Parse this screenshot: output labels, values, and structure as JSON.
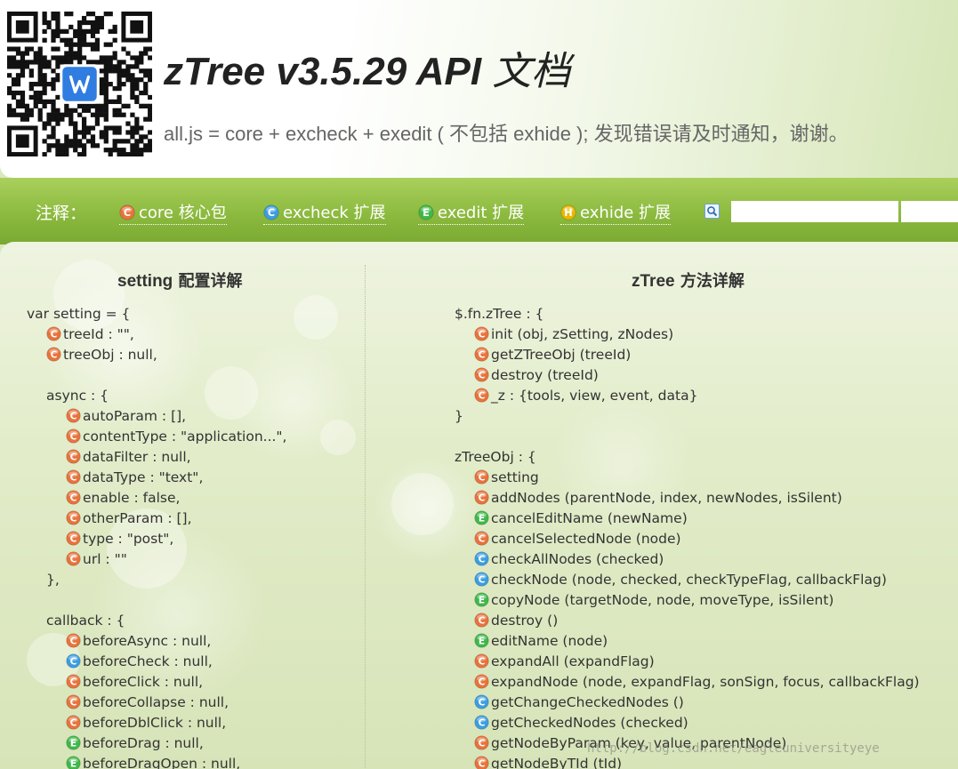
{
  "header": {
    "title_latin": "zTree v3.5.29 API ",
    "title_cn": "文档",
    "subtitle": "all.js = core + excheck + exedit ( 不包括 exhide ); 发现错误请及时通知，谢谢。"
  },
  "legend": {
    "label": "注释：",
    "items": [
      {
        "badge": "C",
        "text": "core 核心包",
        "color": "#e8733c"
      },
      {
        "badge": "C",
        "text": "excheck 扩展",
        "color": "#3b9ee0"
      },
      {
        "badge": "E",
        "text": "exedit 扩展",
        "color": "#3fb84a"
      },
      {
        "badge": "H",
        "text": "exhide 扩展",
        "color": "#e8b800"
      }
    ],
    "search_value": ""
  },
  "colors": {
    "core": "#e8733c",
    "excheck": "#3b9ee0",
    "exedit": "#3fb84a",
    "exhide": "#e8b800"
  },
  "left": {
    "heading_latin": "setting",
    "heading_cn": " 配置详解",
    "lines": [
      {
        "indent": 0,
        "text": "var setting = {"
      },
      {
        "indent": 1,
        "badge": "core",
        "text": "treeId : \"\","
      },
      {
        "indent": 1,
        "badge": "core",
        "text": "treeObj : null,"
      },
      {
        "indent": 0,
        "text": ""
      },
      {
        "indent": 1,
        "text": "async : {"
      },
      {
        "indent": 2,
        "badge": "core",
        "text": "autoParam : [],"
      },
      {
        "indent": 2,
        "badge": "core",
        "text": "contentType : \"application...\","
      },
      {
        "indent": 2,
        "badge": "core",
        "text": "dataFilter : null,"
      },
      {
        "indent": 2,
        "badge": "core",
        "text": "dataType : \"text\","
      },
      {
        "indent": 2,
        "badge": "core",
        "text": "enable : false,"
      },
      {
        "indent": 2,
        "badge": "core",
        "text": "otherParam : [],"
      },
      {
        "indent": 2,
        "badge": "core",
        "text": "type : \"post\","
      },
      {
        "indent": 2,
        "badge": "core",
        "text": "url : \"\""
      },
      {
        "indent": 1,
        "text": "},"
      },
      {
        "indent": 0,
        "text": ""
      },
      {
        "indent": 1,
        "text": "callback : {"
      },
      {
        "indent": 2,
        "badge": "core",
        "text": "beforeAsync : null,"
      },
      {
        "indent": 2,
        "badge": "excheck",
        "text": "beforeCheck : null,"
      },
      {
        "indent": 2,
        "badge": "core",
        "text": "beforeClick : null,"
      },
      {
        "indent": 2,
        "badge": "core",
        "text": "beforeCollapse : null,"
      },
      {
        "indent": 2,
        "badge": "core",
        "text": "beforeDblClick : null,"
      },
      {
        "indent": 2,
        "badge": "exedit",
        "text": "beforeDrag : null,"
      },
      {
        "indent": 2,
        "badge": "exedit",
        "text": "beforeDragOpen : null,"
      }
    ]
  },
  "right": {
    "heading_latin": "zTree",
    "heading_cn": " 方法详解",
    "lines": [
      {
        "indent": 0,
        "text": "$.fn.zTree : {"
      },
      {
        "indent": 1,
        "badge": "core",
        "text": "init (obj, zSetting, zNodes)"
      },
      {
        "indent": 1,
        "badge": "core",
        "text": "getZTreeObj (treeId)"
      },
      {
        "indent": 1,
        "badge": "core",
        "text": "destroy (treeId)"
      },
      {
        "indent": 1,
        "badge": "core",
        "text": "_z : {tools, view, event, data}"
      },
      {
        "indent": 0,
        "text": "}"
      },
      {
        "indent": 0,
        "text": ""
      },
      {
        "indent": 0,
        "text": "zTreeObj : {"
      },
      {
        "indent": 1,
        "badge": "core",
        "text": "setting"
      },
      {
        "indent": 1,
        "badge": "core",
        "text": "addNodes (parentNode, index, newNodes, isSilent)"
      },
      {
        "indent": 1,
        "badge": "exedit",
        "text": "cancelEditName (newName)"
      },
      {
        "indent": 1,
        "badge": "core",
        "text": "cancelSelectedNode (node)"
      },
      {
        "indent": 1,
        "badge": "excheck",
        "text": "checkAllNodes (checked)"
      },
      {
        "indent": 1,
        "badge": "excheck",
        "text": "checkNode (node, checked, checkTypeFlag, callbackFlag)"
      },
      {
        "indent": 1,
        "badge": "exedit",
        "text": "copyNode (targetNode, node, moveType, isSilent)"
      },
      {
        "indent": 1,
        "badge": "core",
        "text": "destroy ()"
      },
      {
        "indent": 1,
        "badge": "exedit",
        "text": "editName (node)"
      },
      {
        "indent": 1,
        "badge": "core",
        "text": "expandAll (expandFlag)"
      },
      {
        "indent": 1,
        "badge": "core",
        "text": "expandNode (node, expandFlag, sonSign, focus, callbackFlag)"
      },
      {
        "indent": 1,
        "badge": "excheck",
        "text": "getChangeCheckedNodes ()"
      },
      {
        "indent": 1,
        "badge": "excheck",
        "text": "getCheckedNodes (checked)"
      },
      {
        "indent": 1,
        "badge": "core",
        "text": "getNodeByParam (key, value, parentNode)"
      },
      {
        "indent": 1,
        "badge": "core",
        "text": "getNodeByTId (tId)"
      }
    ]
  },
  "watermark": "http://blog.csdn.net/eagleuniversityeye",
  "badge_letters": {
    "core": "C",
    "excheck": "C",
    "exedit": "E",
    "exhide": "H"
  }
}
